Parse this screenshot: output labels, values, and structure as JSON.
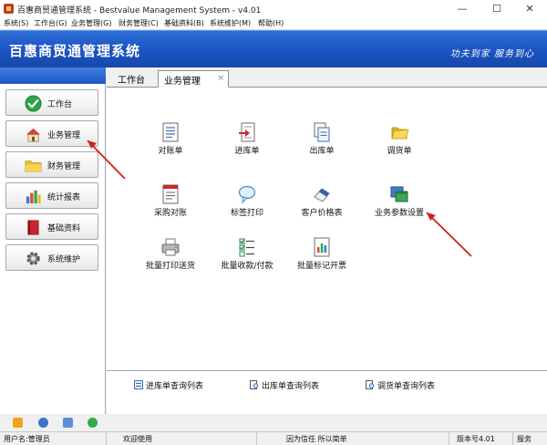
{
  "window": {
    "title": "百惠商贸通管理系统 - Bestvalue Management System - v4.01",
    "minimize_glyph": "—",
    "maximize_glyph": "☐",
    "close_glyph": "✕"
  },
  "menu": [
    "系统(S)",
    "工作台(G)",
    "业务管理(G)",
    "财务管理(C)",
    "基础资料(B)",
    "系统维护(M)",
    "帮助(H)"
  ],
  "banner": {
    "title": "百惠商贸通管理系统",
    "slogan": "功夫到家 服务到心"
  },
  "sidebar": {
    "items": [
      {
        "label": "工作台",
        "icon": "check-circle-icon"
      },
      {
        "label": "业务管理",
        "icon": "house-icon"
      },
      {
        "label": "财务管理",
        "icon": "folder-icon"
      },
      {
        "label": "统计报表",
        "icon": "bar-chart-icon"
      },
      {
        "label": "基础资料",
        "icon": "book-icon"
      },
      {
        "label": "系统维护",
        "icon": "gear-icon"
      }
    ]
  },
  "tabs": {
    "workbench": "工作台",
    "active": "业务管理",
    "close": "×"
  },
  "features": {
    "reconcile": "对账单",
    "stock_in": "进库单",
    "stock_out": "出库单",
    "transfer": "调货单",
    "purchase_reconcile": "采购对账",
    "label_print": "标签打印",
    "customer_price": "客户价格表",
    "business_settings": "业务参数设置",
    "batch_print": "批量打印送货",
    "batch_payment": "批量收款/付款",
    "batch_invoice": "批量标记开票"
  },
  "quick_links": {
    "stock_in_list": "进库单查询列表",
    "stock_out_list": "出库单查询列表",
    "transfer_list": "调货单查询列表"
  },
  "status": {
    "user": "用户名:管理员",
    "welcome": "欢迎使用",
    "motto": "因为信任 所以简单",
    "version": "版本号4.01",
    "service": "服务"
  },
  "colors": {
    "banner": "#1d57c6",
    "annotation_arrow": "#d11f1f"
  }
}
